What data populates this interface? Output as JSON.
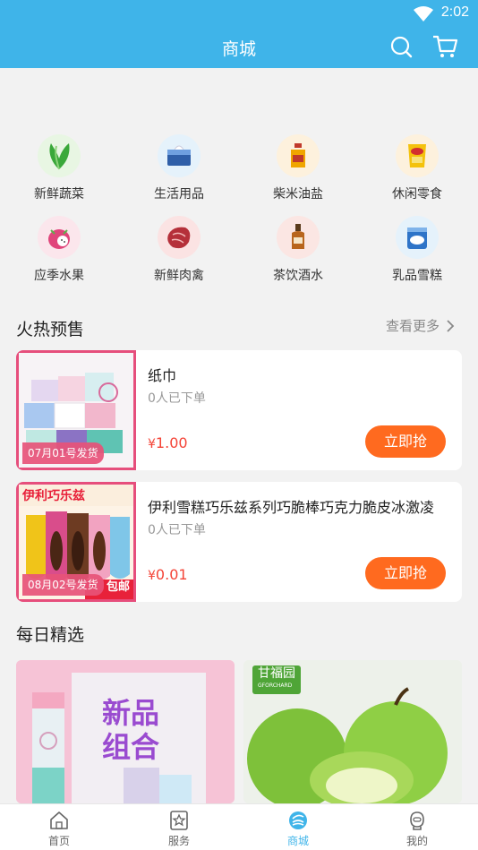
{
  "status": {
    "time": "2:02"
  },
  "header": {
    "title": "商城"
  },
  "categories": [
    {
      "label": "新鲜蔬菜",
      "icon": "vegetable-icon",
      "color": "#e8f6e3"
    },
    {
      "label": "生活用品",
      "icon": "tissue-icon",
      "color": "#e5f2fb"
    },
    {
      "label": "柴米油盐",
      "icon": "oil-bottle-icon",
      "color": "#fdf1dd"
    },
    {
      "label": "休闲零食",
      "icon": "chips-icon",
      "color": "#fdf1dd"
    },
    {
      "label": "应季水果",
      "icon": "dragon-fruit-icon",
      "color": "#fbe6ec"
    },
    {
      "label": "新鲜肉禽",
      "icon": "meat-icon",
      "color": "#fbe3e3"
    },
    {
      "label": "茶饮酒水",
      "icon": "liquor-bottle-icon",
      "color": "#fbe6e3"
    },
    {
      "label": "乳品雪糕",
      "icon": "ice-cream-icon",
      "color": "#e5f2fb"
    }
  ],
  "presale": {
    "title": "火热预售",
    "more": "查看更多",
    "items": [
      {
        "name": "纸巾",
        "sold": "0人已下单",
        "currency": "¥",
        "price": "1.00",
        "button": "立即抢",
        "date": "07月01号发货"
      },
      {
        "name": "伊利雪糕巧乐兹系列巧脆棒巧克力脆皮冰激凌",
        "sold": "0人已下单",
        "currency": "¥",
        "price": "0.01",
        "button": "立即抢",
        "date": "08月02号发货",
        "image_text": {
          "brand": "伊利巧乐兹",
          "tag": "包邮"
        }
      }
    ]
  },
  "daily": {
    "title": "每日精选",
    "items": [
      {
        "image_text": "新品组合"
      },
      {
        "image_text": "甘福园",
        "image_subtext": "GFORCHARD"
      }
    ]
  },
  "tabs": [
    {
      "label": "首页",
      "icon": "home-icon",
      "active": false
    },
    {
      "label": "服务",
      "icon": "service-star-icon",
      "active": false
    },
    {
      "label": "商城",
      "icon": "mall-icon",
      "active": true
    },
    {
      "label": "我的",
      "icon": "profile-icon",
      "active": false
    }
  ]
}
